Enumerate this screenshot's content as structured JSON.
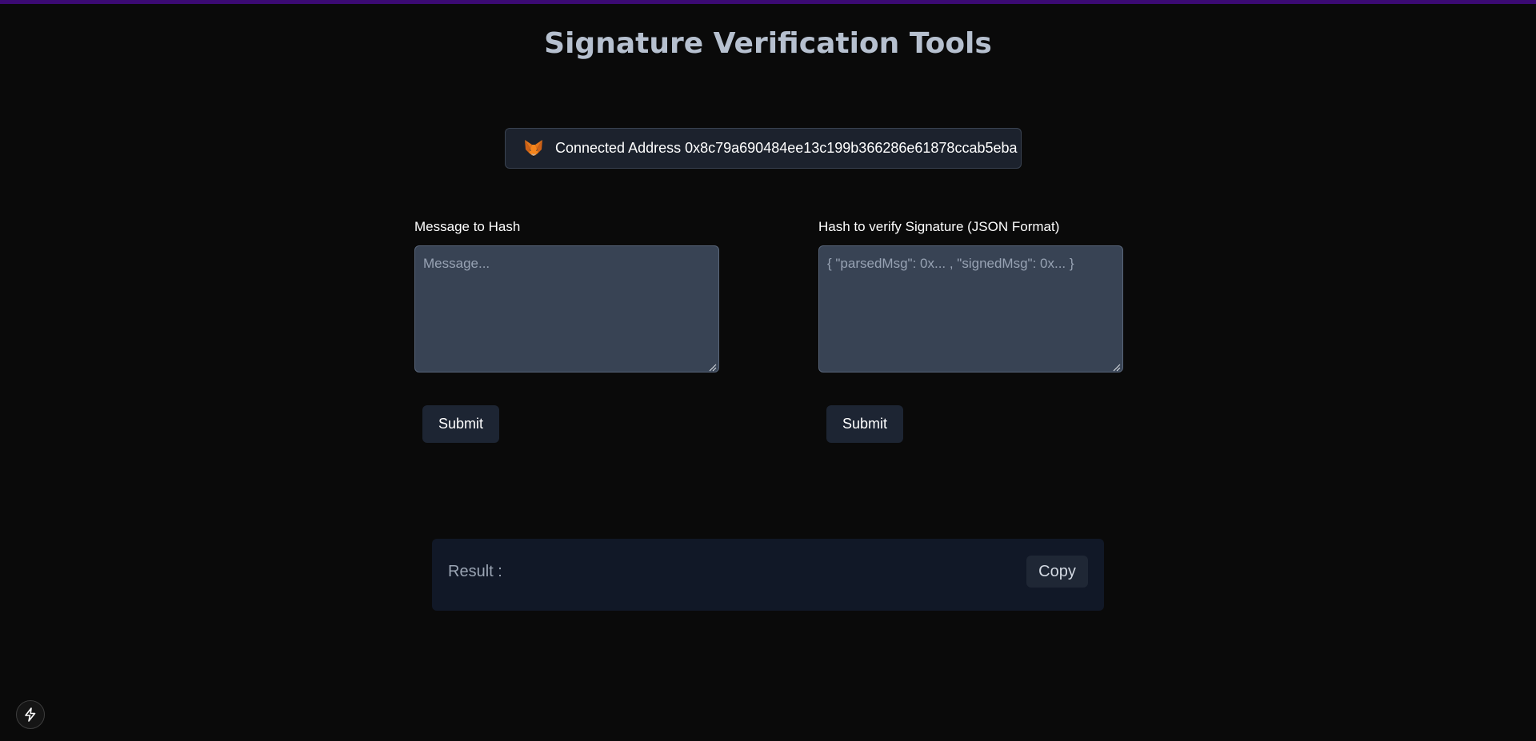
{
  "page": {
    "title": "Signature Verification Tools"
  },
  "wallet": {
    "icon": "metamask-fox-icon",
    "connected_text": "Connected Address 0x8c79a690484ee13c199b366286e61878ccab5eba"
  },
  "hash_form": {
    "label": "Message to Hash",
    "placeholder": "Message...",
    "value": "",
    "submit_label": "Submit"
  },
  "verify_form": {
    "label": "Hash to verify Signature (JSON Format)",
    "placeholder": "{ \"parsedMsg\": 0x... , \"signedMsg\": 0x... }",
    "value": "",
    "submit_label": "Submit"
  },
  "result": {
    "label": "Result :",
    "copy_label": "Copy"
  },
  "corner_badge": {
    "icon": "lightning-bolt-icon"
  },
  "colors": {
    "background": "#0a0a0a",
    "accent_bar": "#3b0a73",
    "title": "#b6c0cf",
    "input_bg": "#384354",
    "button_bg": "#1d2533",
    "result_bg": "#111827"
  }
}
